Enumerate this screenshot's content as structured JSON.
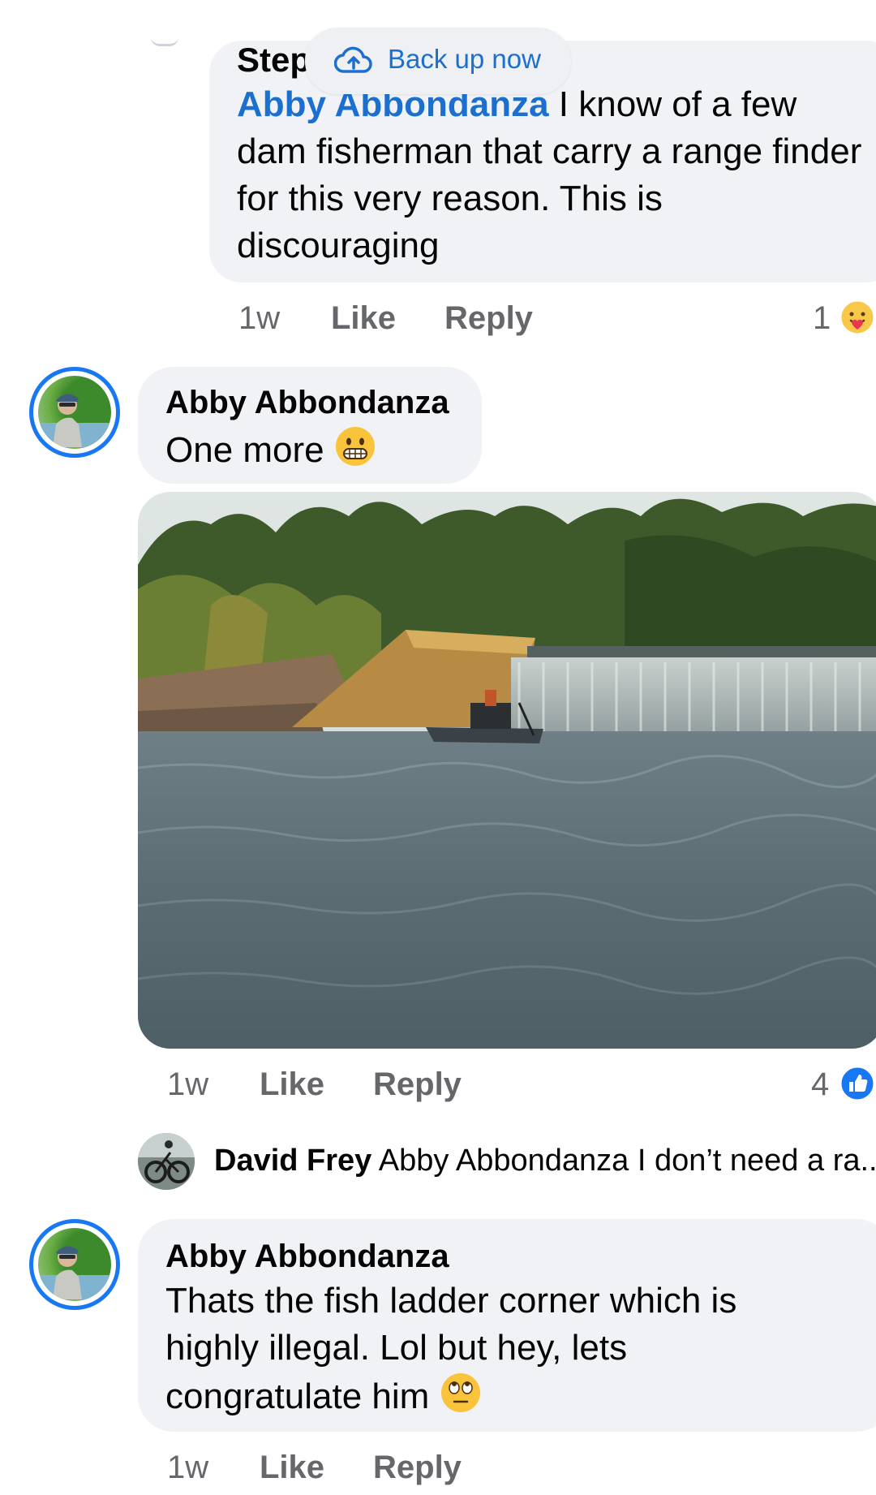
{
  "backup_banner": {
    "label": "Back up now"
  },
  "comments": [
    {
      "author_partial": "Step",
      "mention": "Abby Abbondanza",
      "text": " I know of a few dam fisherman that carry a range finder for this very reason. This is discouraging",
      "time": "1w",
      "like_label": "Like",
      "reply_label": "Reply",
      "reaction_count": "1",
      "reaction_icon": "care-reaction-icon"
    },
    {
      "author": "Abby Abbondanza",
      "text": "One more",
      "emoji": "grimacing-face-emoji",
      "time": "1w",
      "like_label": "Like",
      "reply_label": "Reply",
      "reaction_count": "4",
      "reaction_icon": "like-reaction-icon",
      "reply_preview": {
        "author": "David Frey",
        "text": "Abby Abbondanza I don’t need a ra..."
      }
    },
    {
      "author": "Abby Abbondanza",
      "text": "Thats the fish ladder corner which is highly illegal. Lol but hey, lets congratulate him",
      "emoji": "face-with-rolling-eyes-emoji",
      "time": "1w",
      "like_label": "Like",
      "reply_label": "Reply"
    }
  ],
  "colors": {
    "link": "#1b6fcf",
    "bubble": "#f0f2f5",
    "meta": "#65676b",
    "avatar_ring": "#1877f2"
  }
}
